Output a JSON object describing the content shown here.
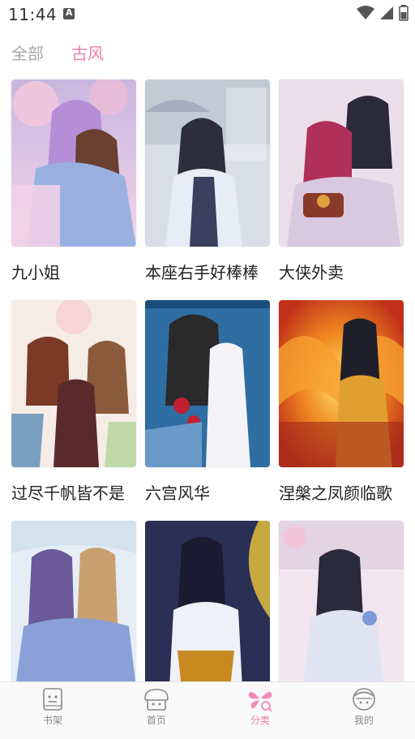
{
  "status_bar": {
    "time": "11:44"
  },
  "tabs": {
    "all": "全部",
    "gufeng": "古风"
  },
  "comics": [
    {
      "title": "九小姐",
      "cover_text": ""
    },
    {
      "title": "本座右手好棒棒",
      "cover_text": ""
    },
    {
      "title": "大侠外卖",
      "cover_text": ""
    },
    {
      "title": "过尽千帆皆不是",
      "cover_text": ""
    },
    {
      "title": "六宫风华",
      "cover_text": ""
    },
    {
      "title": "涅槃之凤颜临歌",
      "cover_text": ""
    },
    {
      "title": "",
      "cover_text": ""
    },
    {
      "title": "",
      "cover_text": ""
    },
    {
      "title": "",
      "cover_text": ""
    }
  ],
  "bottom_nav": {
    "bookshelf": "书架",
    "home": "首页",
    "category": "分类",
    "mine": "我的"
  },
  "colors": {
    "accent": "#ee7fae",
    "inactive": "#a7a7a7"
  }
}
